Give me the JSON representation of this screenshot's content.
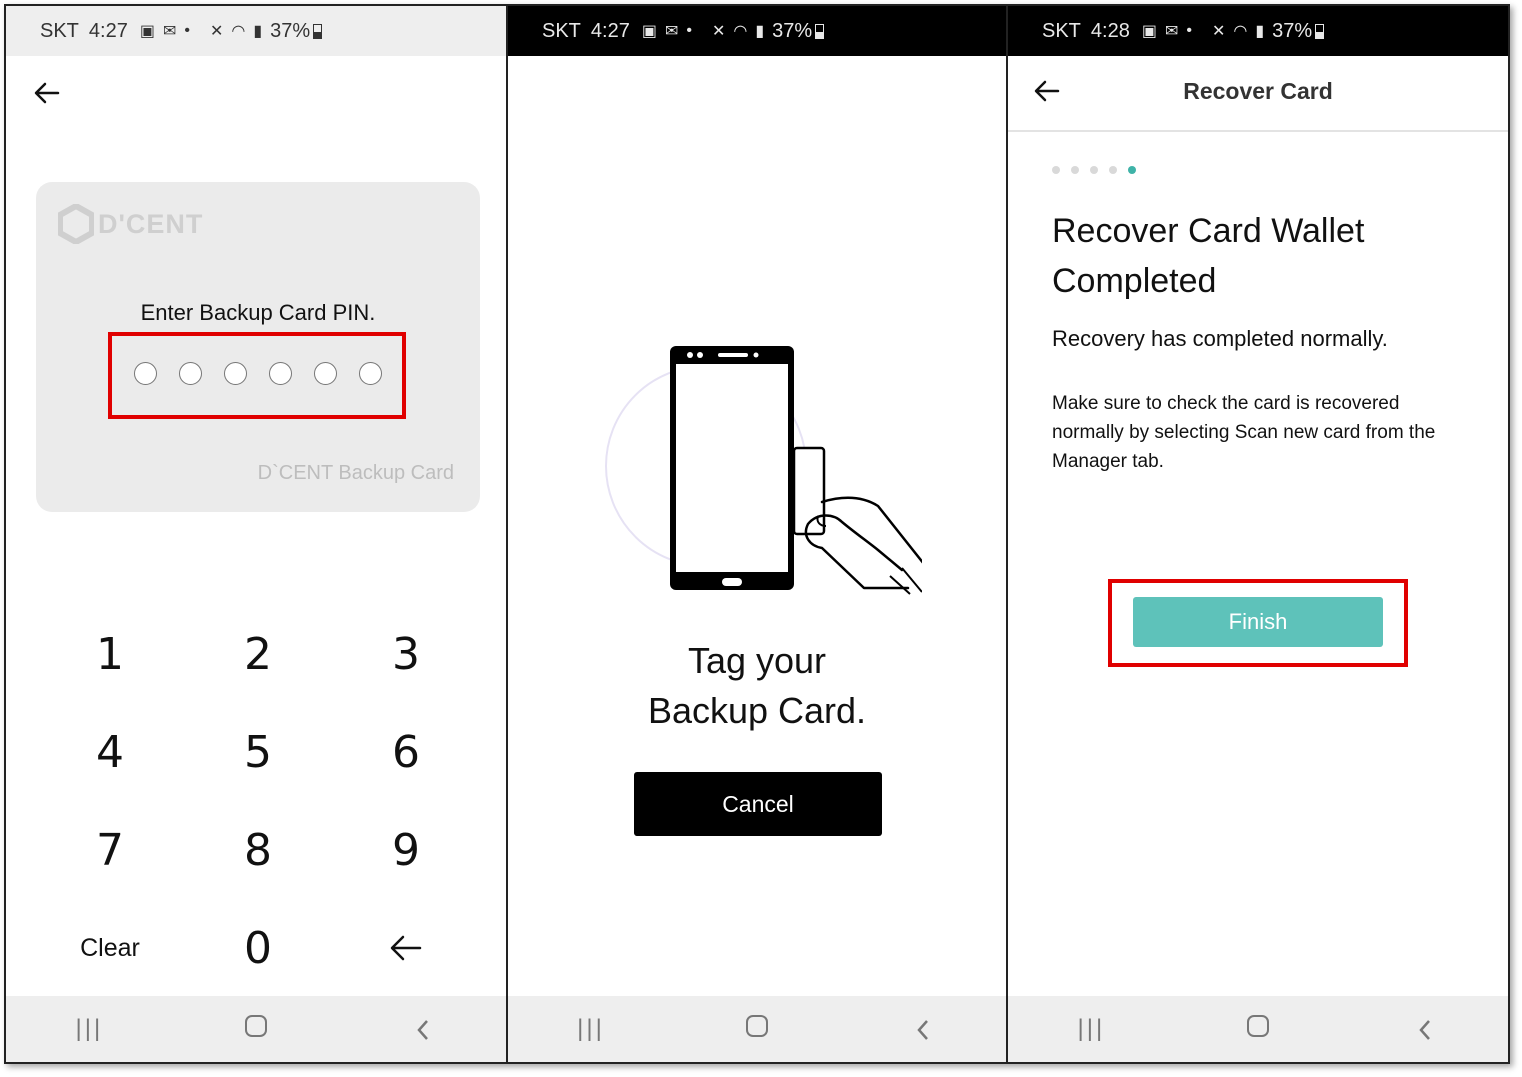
{
  "status_bars": [
    {
      "carrier": "SKT",
      "time": "4:27",
      "battery": "37%"
    },
    {
      "carrier": "SKT",
      "time": "4:27",
      "battery": "37%"
    },
    {
      "carrier": "SKT",
      "time": "4:28",
      "battery": "37%"
    }
  ],
  "screen1": {
    "card": {
      "brand": "D'CENT",
      "pin_label": "Enter Backup Card PIN.",
      "pin_length": 6,
      "pin_entered": 0,
      "footer": "D`CENT Backup Card"
    },
    "keypad": [
      "1",
      "2",
      "3",
      "4",
      "5",
      "6",
      "7",
      "8",
      "9",
      "Clear",
      "0"
    ]
  },
  "screen2": {
    "instruction_line1": "Tag your",
    "instruction_line2": "Backup Card.",
    "cancel_label": "Cancel"
  },
  "screen3": {
    "header_title": "Recover Card",
    "steps_total": 5,
    "current_step": 5,
    "heading_line1": "Recover Card Wallet",
    "heading_line2": "Completed",
    "message": "Recovery has completed normally.",
    "note": "Make sure to check the card is recovered normally by selecting Scan new card from the Manager tab.",
    "finish_label": "Finish"
  },
  "colors": {
    "highlight": "#e00000",
    "accent": "#5ec2ba",
    "step_active": "#3fb3a8"
  },
  "icons": [
    "image-icon",
    "mail-icon",
    "mute-icon",
    "wifi-icon",
    "signal-icon",
    "battery-icon",
    "back-arrow-icon",
    "backspace-icon",
    "recents-icon",
    "home-icon",
    "nav-back-icon"
  ]
}
